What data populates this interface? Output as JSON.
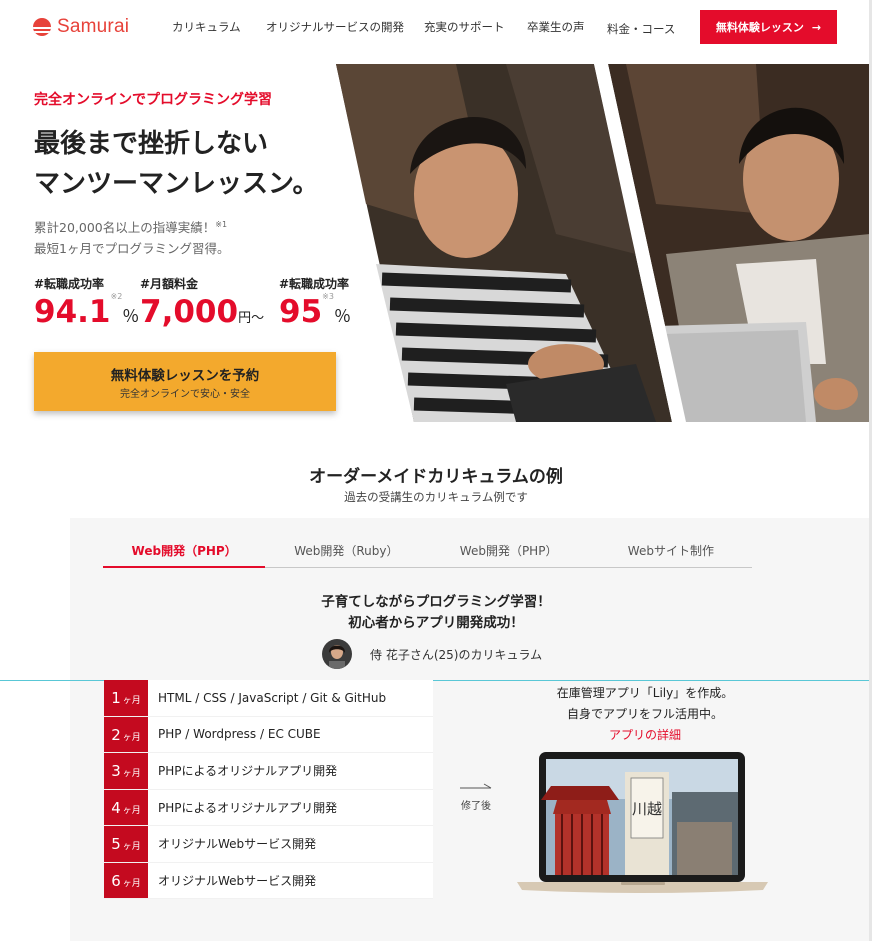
{
  "header": {
    "logo": "Samurai",
    "nav": [
      "カリキュラム",
      "オリジナルサービスの開発",
      "充実のサポート",
      "卒業生の声",
      "料金・コース"
    ],
    "cta": "無料体験レッスン",
    "cta_arrow": "→"
  },
  "hero": {
    "tagline": "完全オンラインでプログラミング学習",
    "title_line1": "最後まで挫折しない",
    "title_line2": "マンツーマンレッスン。",
    "sub_line1": "累計20,000名以上の指導実績！",
    "sub_note1": "※1",
    "sub_line2": "最短1ヶ月でプログラミング習得。",
    "stats": [
      {
        "label": "#転職成功率",
        "value": "94.1",
        "note": "※2",
        "unit": "％"
      },
      {
        "label": "#月額料金",
        "value": "7,000",
        "note": "",
        "unit": "円〜"
      },
      {
        "label": "#転職成功率",
        "value": "95",
        "note": "※3",
        "unit": "％"
      }
    ],
    "cta_label": "無料体験レッスンを予約",
    "cta_sub": "完全オンラインで安心・安全"
  },
  "section": {
    "title": "オーダーメイドカリキュラムの例",
    "subtitle": "過去の受講生のカリキュラム例です",
    "tabs": [
      "Web開発（PHP）",
      "Web開発（Ruby）",
      "Web開発（PHP）",
      "Webサイト制作"
    ],
    "active_tab": 0,
    "case_title_line1": "子育てしながらプログラミング学習！",
    "case_title_line2": "初心者からアプリ開発成功！",
    "person": "侍 花子さん(25)のカリキュラム",
    "month_unit": "ヶ月",
    "months": [
      {
        "n": "1",
        "text": "HTML / CSS / JavaScript / Git & GitHub"
      },
      {
        "n": "2",
        "text": "PHP / Wordpress / EC CUBE"
      },
      {
        "n": "3",
        "text": "PHPによるオリジナルアプリ開発"
      },
      {
        "n": "4",
        "text": "PHPによるオリジナルアプリ開発"
      },
      {
        "n": "5",
        "text": "オリジナルWebサービス開発"
      },
      {
        "n": "6",
        "text": "オリジナルWebサービス開発"
      }
    ],
    "after_label": "修了後",
    "result_line1": "在庫管理アプリ「Lily」を作成。",
    "result_line2": "自身でアプリをフル活用中。",
    "result_link": "アプリの詳細",
    "laptop_screen_text": "川越"
  },
  "colors": {
    "brand_red": "#e40c2b",
    "cta_orange": "#f3a92d",
    "month_red": "#c40a1f"
  }
}
